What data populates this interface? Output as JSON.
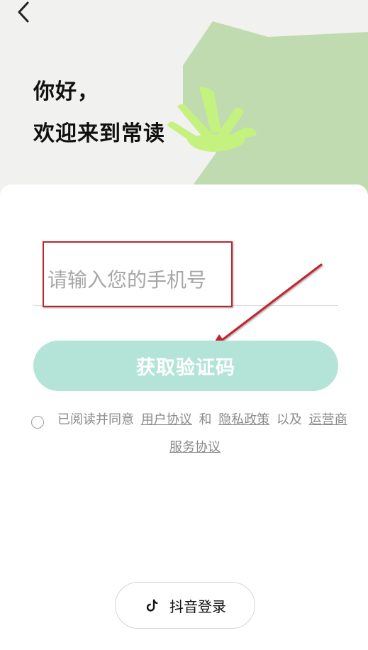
{
  "header": {
    "greeting_line1": "你好，",
    "greeting_line2": "欢迎来到常读"
  },
  "form": {
    "phone_placeholder": "请输入您的手机号",
    "get_code_label": "获取验证码"
  },
  "agreement": {
    "prefix": "已阅读并同意",
    "user_agreement": "用户协议",
    "and": "和",
    "privacy_policy": "隐私政策",
    "as_well_as": "以及",
    "carrier": "运营商",
    "service_agreement": "服务协议"
  },
  "douyin_login": {
    "label": "抖音登录",
    "icon": "tiktok-icon"
  },
  "colors": {
    "header_bg": "#f1f1ef",
    "leaf_green": "#c1dbb0",
    "sprout_green": "#c5f27f",
    "button_bg": "#b4e4d8",
    "annotation_red": "#c0262d"
  }
}
